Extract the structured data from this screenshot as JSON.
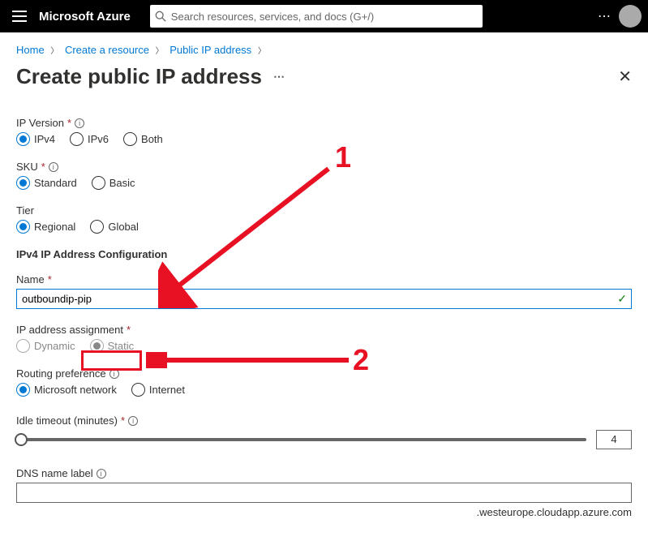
{
  "topbar": {
    "brand": "Microsoft Azure",
    "search_placeholder": "Search resources, services, and docs (G+/)"
  },
  "breadcrumb": {
    "items": [
      "Home",
      "Create a resource",
      "Public IP address"
    ]
  },
  "title": "Create public IP address",
  "ipversion": {
    "label": "IP Version",
    "opts": [
      "IPv4",
      "IPv6",
      "Both"
    ]
  },
  "sku": {
    "label": "SKU",
    "opts": [
      "Standard",
      "Basic"
    ]
  },
  "tier": {
    "label": "Tier",
    "opts": [
      "Regional",
      "Global"
    ]
  },
  "section_head": "IPv4 IP Address Configuration",
  "name": {
    "label": "Name",
    "value": "outboundip-pip"
  },
  "assign": {
    "label": "IP address assignment",
    "opts": [
      "Dynamic",
      "Static"
    ]
  },
  "routing": {
    "label": "Routing preference",
    "opts": [
      "Microsoft network",
      "Internet"
    ]
  },
  "idle": {
    "label": "Idle timeout (minutes)",
    "value": "4"
  },
  "dns": {
    "label": "DNS name label",
    "suffix": ".westeurope.cloudapp.azure.com"
  },
  "annotations": {
    "n1": "1",
    "n2": "2"
  }
}
